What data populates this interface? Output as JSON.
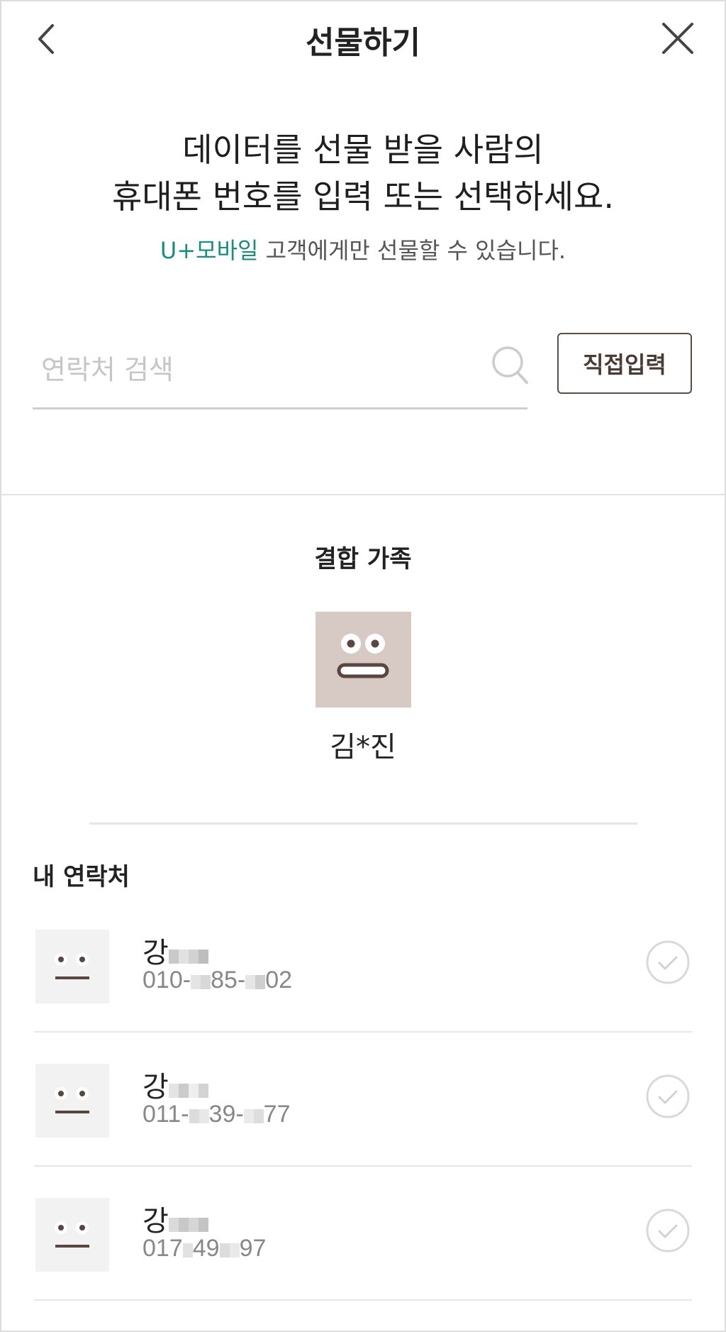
{
  "header": {
    "title": "선물하기",
    "back_icon": "chevron-left-icon",
    "close_icon": "close-icon"
  },
  "intro": {
    "headline_line1": "데이터를 선물 받을 사람의",
    "headline_line2": "휴대폰 번호를 입력 또는 선택하세요.",
    "brand": "U+모바일",
    "notice": " 고객에게만 선물할 수 있습니다."
  },
  "search": {
    "placeholder": "연락처 검색",
    "value": "",
    "icon": "search-icon",
    "direct_input_label": "직접입력"
  },
  "family": {
    "title": "결합 가족",
    "member_name": "김*진"
  },
  "contacts": {
    "title": "내 연락처",
    "items": [
      {
        "name": "강",
        "phone": [
          "010-",
          "85-",
          "02"
        ]
      },
      {
        "name": "강",
        "phone": [
          "011-",
          "39-",
          "77"
        ]
      },
      {
        "name": "강",
        "phone": [
          "017",
          "49",
          "97"
        ]
      }
    ]
  },
  "colors": {
    "brand_accent": "#1a8c80",
    "button_border": "#5e4c45",
    "family_avatar_bg": "#d7cac5",
    "contact_avatar_bg": "#f2f2f2"
  }
}
